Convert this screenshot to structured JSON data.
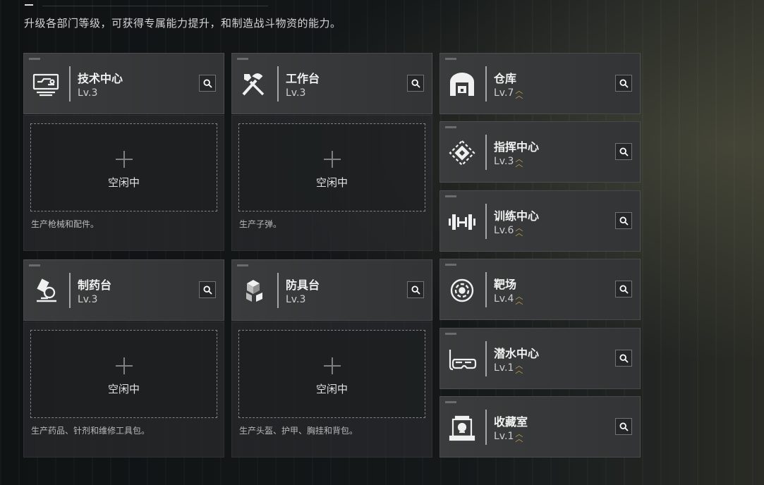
{
  "header": {
    "subtitle": "升级各部门等级，可获得专属能力提升，和制造战斗物资的能力。"
  },
  "colors": {
    "upgrade_arrow": "#c9a449",
    "card_bg": "#3a3c3d"
  },
  "workstations": [
    {
      "name": "技术中心",
      "level": "Lv.3",
      "icon": "computer-icon",
      "slot_status": "空闲中",
      "description": "生产枪械和配件。"
    },
    {
      "name": "工作台",
      "level": "Lv.3",
      "icon": "tools-icon",
      "slot_status": "空闲中",
      "description": "生产子弹。"
    },
    {
      "name": "制药台",
      "level": "Lv.3",
      "icon": "microscope-icon",
      "slot_status": "空闲中",
      "description": "生产药品、针剂和维修工具包。"
    },
    {
      "name": "防具台",
      "level": "Lv.3",
      "icon": "cubes-icon",
      "slot_status": "空闲中",
      "description": "生产头盔、护甲、胸挂和背包。"
    }
  ],
  "facilities": [
    {
      "name": "仓库",
      "level": "Lv.7",
      "icon": "warehouse-icon",
      "upgradable": true
    },
    {
      "name": "指挥中心",
      "level": "Lv.3",
      "icon": "command-icon",
      "upgradable": true
    },
    {
      "name": "训练中心",
      "level": "Lv.6",
      "icon": "dumbbell-icon",
      "upgradable": true
    },
    {
      "name": "靶场",
      "level": "Lv.4",
      "icon": "target-icon",
      "upgradable": true
    },
    {
      "name": "潜水中心",
      "level": "Lv.1",
      "icon": "diving-mask-icon",
      "upgradable": true
    },
    {
      "name": "收藏室",
      "level": "Lv.1",
      "icon": "display-case-icon",
      "upgradable": true
    }
  ]
}
